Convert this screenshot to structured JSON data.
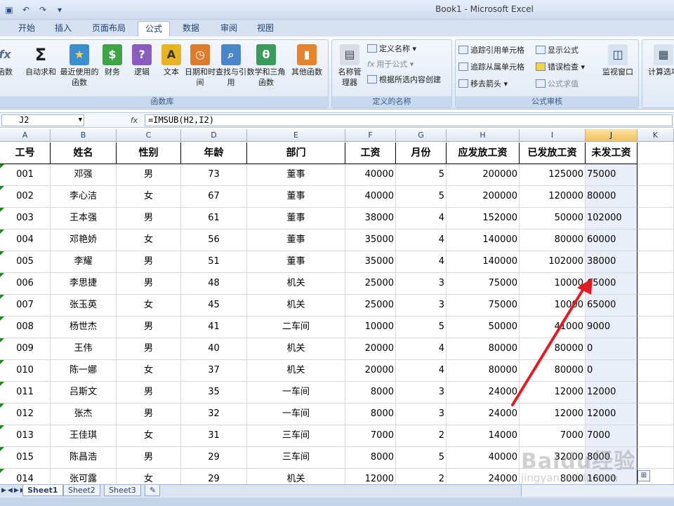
{
  "window": {
    "title": "Book1 - Microsoft Excel"
  },
  "tabs": [
    "开始",
    "插入",
    "页面布局",
    "公式",
    "数据",
    "审阅",
    "视图"
  ],
  "ribbon": {
    "group_function_library": {
      "label": "函数库",
      "buttons": [
        {
          "label": "函数",
          "icon": "fx-icon",
          "color": "#5a6f8f"
        },
        {
          "label": "自动求和",
          "icon": "sigma-icon",
          "color": "#2b2b2b"
        },
        {
          "label": "最近使用的函数",
          "icon": "star-book-icon",
          "color": "#3b8fd1"
        },
        {
          "label": "财务",
          "icon": "finance-book-icon",
          "color": "#3da544"
        },
        {
          "label": "逻辑",
          "icon": "logic-book-icon",
          "color": "#8a5cc0"
        },
        {
          "label": "文本",
          "icon": "text-book-icon",
          "color": "#e6b422"
        },
        {
          "label": "日期和时间",
          "icon": "date-book-icon",
          "color": "#e07a2b"
        },
        {
          "label": "查找与引用",
          "icon": "lookup-book-icon",
          "color": "#4a86c9"
        },
        {
          "label": "数学和三角函数",
          "icon": "math-book-icon",
          "color": "#3a9c5a"
        },
        {
          "label": "其他函数",
          "icon": "more-books-icon",
          "color": "#e7832a"
        }
      ]
    },
    "group_defined_names": {
      "label": "定义的名称",
      "name_manager": "名称管理器",
      "define_name": "定义名称",
      "use_in_formula": "用于公式",
      "create_from_selection": "根据所选内容创建"
    },
    "group_formula_auditing": {
      "label": "公式审核",
      "trace_precedents": "追踪引用单元格",
      "trace_dependents": "追踪从属单元格",
      "remove_arrows": "移去箭头",
      "show_formulas": "显示公式",
      "error_checking": "错误检查",
      "evaluate_formula": "公式求值",
      "watch_window": "监视窗口"
    },
    "group_calculation": {
      "calc_options": "计算选项"
    }
  },
  "formula_bar": {
    "name_box": "J2",
    "fx": "fx",
    "formula": "=IMSUB(H2,I2)"
  },
  "columns": [
    "A",
    "B",
    "C",
    "D",
    "E",
    "F",
    "G",
    "H",
    "I",
    "J",
    "K"
  ],
  "headers": [
    "工号",
    "姓名",
    "性别",
    "年龄",
    "部门",
    "工资",
    "月份",
    "应发放工资",
    "已发放工资",
    "未发工资"
  ],
  "rows": [
    [
      "001",
      "邓强",
      "男",
      "73",
      "董事",
      "40000",
      "5",
      "200000",
      "125000",
      "75000"
    ],
    [
      "002",
      "李心洁",
      "女",
      "67",
      "董事",
      "40000",
      "5",
      "200000",
      "120000",
      "80000"
    ],
    [
      "003",
      "王本强",
      "男",
      "61",
      "董事",
      "38000",
      "4",
      "152000",
      "50000",
      "102000"
    ],
    [
      "004",
      "邓艳娇",
      "女",
      "56",
      "董事",
      "35000",
      "4",
      "140000",
      "80000",
      "60000"
    ],
    [
      "005",
      "李耀",
      "男",
      "51",
      "董事",
      "35000",
      "4",
      "140000",
      "102000",
      "38000"
    ],
    [
      "006",
      "李思捷",
      "男",
      "48",
      "机关",
      "25000",
      "3",
      "75000",
      "10000",
      "65000"
    ],
    [
      "007",
      "张玉英",
      "女",
      "45",
      "机关",
      "25000",
      "3",
      "75000",
      "10000",
      "65000"
    ],
    [
      "008",
      "杨世杰",
      "男",
      "41",
      "二车间",
      "10000",
      "5",
      "50000",
      "41000",
      "9000"
    ],
    [
      "009",
      "王伟",
      "男",
      "40",
      "机关",
      "20000",
      "4",
      "80000",
      "80000",
      "0"
    ],
    [
      "010",
      "陈一娜",
      "女",
      "37",
      "机关",
      "20000",
      "4",
      "80000",
      "80000",
      "0"
    ],
    [
      "011",
      "吕斯文",
      "男",
      "35",
      "一车间",
      "8000",
      "3",
      "24000",
      "12000",
      "12000"
    ],
    [
      "012",
      "张杰",
      "男",
      "32",
      "一车间",
      "8000",
      "3",
      "24000",
      "12000",
      "12000"
    ],
    [
      "013",
      "王佳琪",
      "女",
      "31",
      "三车间",
      "7000",
      "2",
      "14000",
      "7000",
      "7000"
    ],
    [
      "015",
      "陈昌浩",
      "男",
      "29",
      "三车间",
      "8000",
      "5",
      "40000",
      "32000",
      "8000"
    ],
    [
      "014",
      "张可露",
      "女",
      "29",
      "机关",
      "12000",
      "2",
      "24000",
      "8000",
      "16000"
    ]
  ],
  "sheets": [
    "Sheet1",
    "Sheet2",
    "Sheet3"
  ],
  "watermark": {
    "line1": "Baidu经验",
    "line2": "jingyan.baidu.com"
  },
  "colors": {
    "accent_arrow": "#e31b23",
    "selected_col": "#e9eef8"
  }
}
